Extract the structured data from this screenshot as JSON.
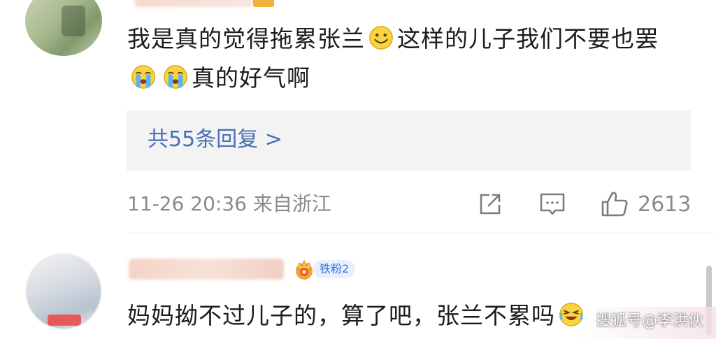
{
  "comments": [
    {
      "text_parts": [
        "我是真的觉得拖累张兰",
        "这样的儿子我们不要也罢",
        "",
        "真的好气啊"
      ],
      "emojis": [
        "smile-emoji",
        "crying-emoji",
        "crying-emoji"
      ],
      "replies_label": "共55条回复 >",
      "timestamp": "11-26 20:36",
      "location": "来自浙江",
      "like_count": "2613"
    },
    {
      "badge_label": "铁粉2",
      "text": "妈妈拗不过儿子的，算了吧，张兰不累吗",
      "emoji": "crying-laughing-emoji"
    }
  ],
  "watermark": "搜狐号@李洪伙",
  "colors": {
    "link": "#4a6fb5",
    "meta": "#8a8a8a",
    "reply_bg": "#f3f3f3",
    "badge_bg": "#e8f0ff",
    "badge_text": "#3a6fe0"
  }
}
